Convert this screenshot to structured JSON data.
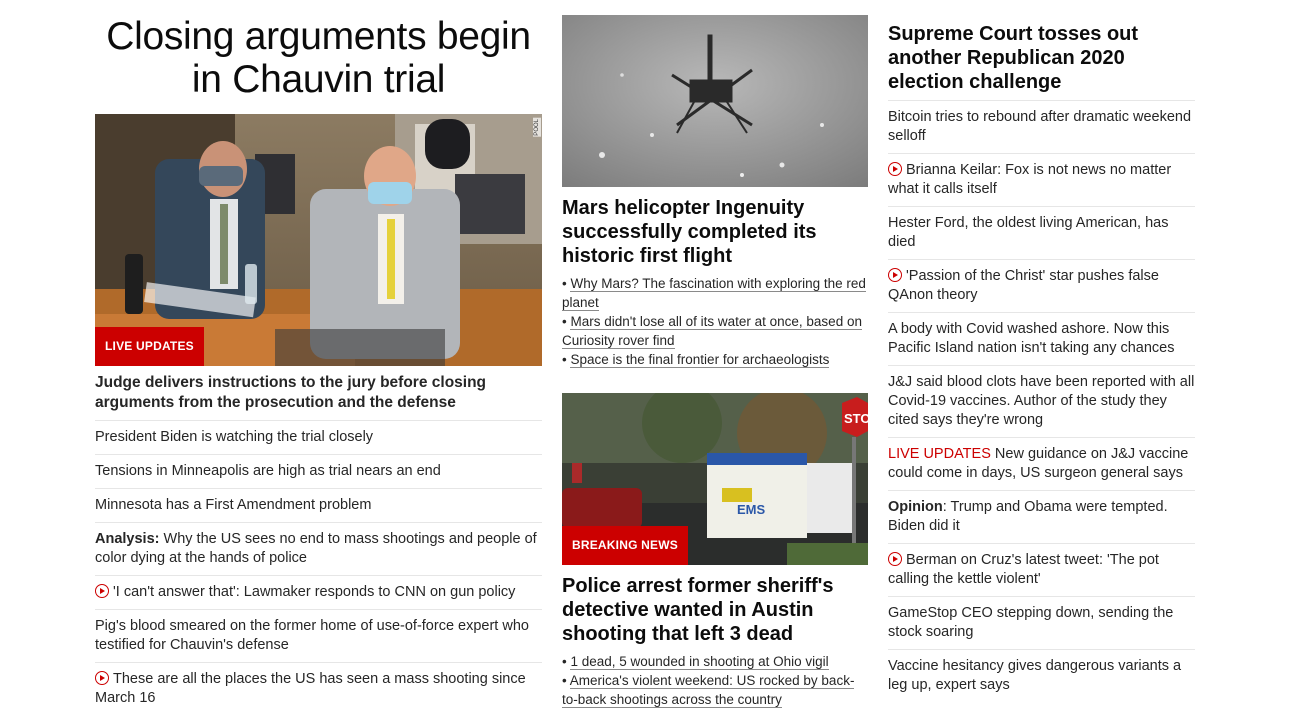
{
  "lead": {
    "headline": "Closing arguments begin in Chauvin trial",
    "badge": "LIVE UPDATES",
    "photo_credit": "POOL",
    "subheadline": "Judge delivers instructions to the jury before closing arguments from the prosecution and the defense",
    "items": [
      {
        "text": "President Biden is watching the trial closely"
      },
      {
        "text": "Tensions in Minneapolis are high as trial nears an end"
      },
      {
        "text": "Minnesota has a First Amendment problem"
      },
      {
        "prefix": "Analysis:",
        "text": " Why the US sees no end to mass shootings and people of color dying at the hands of police"
      },
      {
        "video": true,
        "text": "'I can't answer that': Lawmaker responds to CNN on gun policy"
      },
      {
        "text": "Pig's blood smeared on the former home of use-of-force expert who testified for Chauvin's defense"
      },
      {
        "video": true,
        "text": "These are all the places the US has seen a mass shooting since March 16"
      }
    ]
  },
  "mars": {
    "title": "Mars helicopter Ingenuity successfully completed its historic first flight",
    "bullets": [
      "Why Mars? The fascination with exploring the red planet",
      "Mars didn't lose all of its water at once, based on Curiosity rover find",
      "Space is the final frontier for archaeologists"
    ]
  },
  "austin": {
    "badge": "BREAKING NEWS",
    "sign_text": "STO",
    "ems_text": "EMS",
    "title": "Police arrest former sheriff's detective wanted in Austin shooting that left 3 dead",
    "bullets": [
      "1 dead, 5 wounded in shooting at Ohio vigil",
      "America's violent weekend: US rocked by back-to-back shootings across the country"
    ]
  },
  "right": {
    "headline": "Supreme Court tosses out another Republican 2020 election challenge",
    "items": [
      {
        "text": "Bitcoin tries to rebound after dramatic weekend selloff"
      },
      {
        "video": true,
        "text": "Brianna Keilar: Fox is not news no matter what it calls itself"
      },
      {
        "text": "Hester Ford, the oldest living American, has died"
      },
      {
        "video": true,
        "text": "'Passion of the Christ' star pushes false QAnon theory"
      },
      {
        "text": "A body with Covid washed ashore. Now this Pacific Island nation isn't taking any chances"
      },
      {
        "text": "J&J said blood clots have been reported with all Covid-19 vaccines. Author of the study they cited says they're wrong"
      },
      {
        "live": "LIVE UPDATES",
        "text": " New guidance on J&J vaccine could come in days, US surgeon general says"
      },
      {
        "prefix": "Opinion",
        "text": ": Trump and Obama were tempted. Biden did it"
      },
      {
        "video": true,
        "text": "Berman on Cruz's latest tweet: 'The pot calling the kettle violent'"
      },
      {
        "text": "GameStop CEO stepping down, sending the stock soaring"
      },
      {
        "text": "Vaccine hesitancy gives dangerous variants a leg up, expert says"
      }
    ]
  },
  "colors": {
    "accent": "#cc0000",
    "text": "#262626",
    "divider": "#e6e6e6"
  }
}
